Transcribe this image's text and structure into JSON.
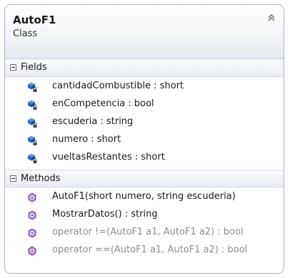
{
  "class_box": {
    "name": "AutoF1",
    "stereotype": "Class",
    "collapse_icon": "double-chevron-up-icon"
  },
  "fields": {
    "title": "Fields",
    "icon": "private-field-icon",
    "items": [
      {
        "label": "cantidadCombustible : short"
      },
      {
        "label": "enCompetencia : bool"
      },
      {
        "label": "escuderia : string"
      },
      {
        "label": "numero : short"
      },
      {
        "label": "vueltasRestantes : short"
      }
    ]
  },
  "methods": {
    "title": "Methods",
    "icon": "method-icon",
    "items": [
      {
        "label": "AutoF1(short numero, string escuderia)"
      },
      {
        "label": "MostrarDatos() : string"
      },
      {
        "label": "operator !=(AutoF1 a1, AutoF1 a2) : bool"
      },
      {
        "label": "operator ==(AutoF1 a1, AutoF1 a2) : bool"
      }
    ]
  },
  "colors": {
    "border": "#a9b3c4",
    "field_icon": "#2b6cc4",
    "method_icon": "#7a3ea8",
    "muted_text": "#8a8f96"
  }
}
